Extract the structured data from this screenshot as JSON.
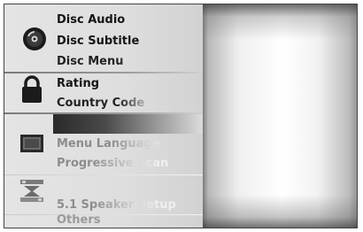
{
  "menu": {
    "disc_group": {
      "icon": "disc-icon",
      "items": [
        "Disc Audio",
        "Disc Subtitle",
        "Disc Menu"
      ]
    },
    "lock_group": {
      "icon": "padlock-icon",
      "items": [
        "Rating",
        "Country Code"
      ]
    },
    "display_group": {
      "icon": "tv-screen-icon",
      "items": [
        "Menu Language",
        "Progressive Scan"
      ]
    },
    "audio_group": {
      "icon": "speaker-settings-icon",
      "items": [
        "5.1 Speaker Setup"
      ]
    },
    "others": "Others"
  }
}
